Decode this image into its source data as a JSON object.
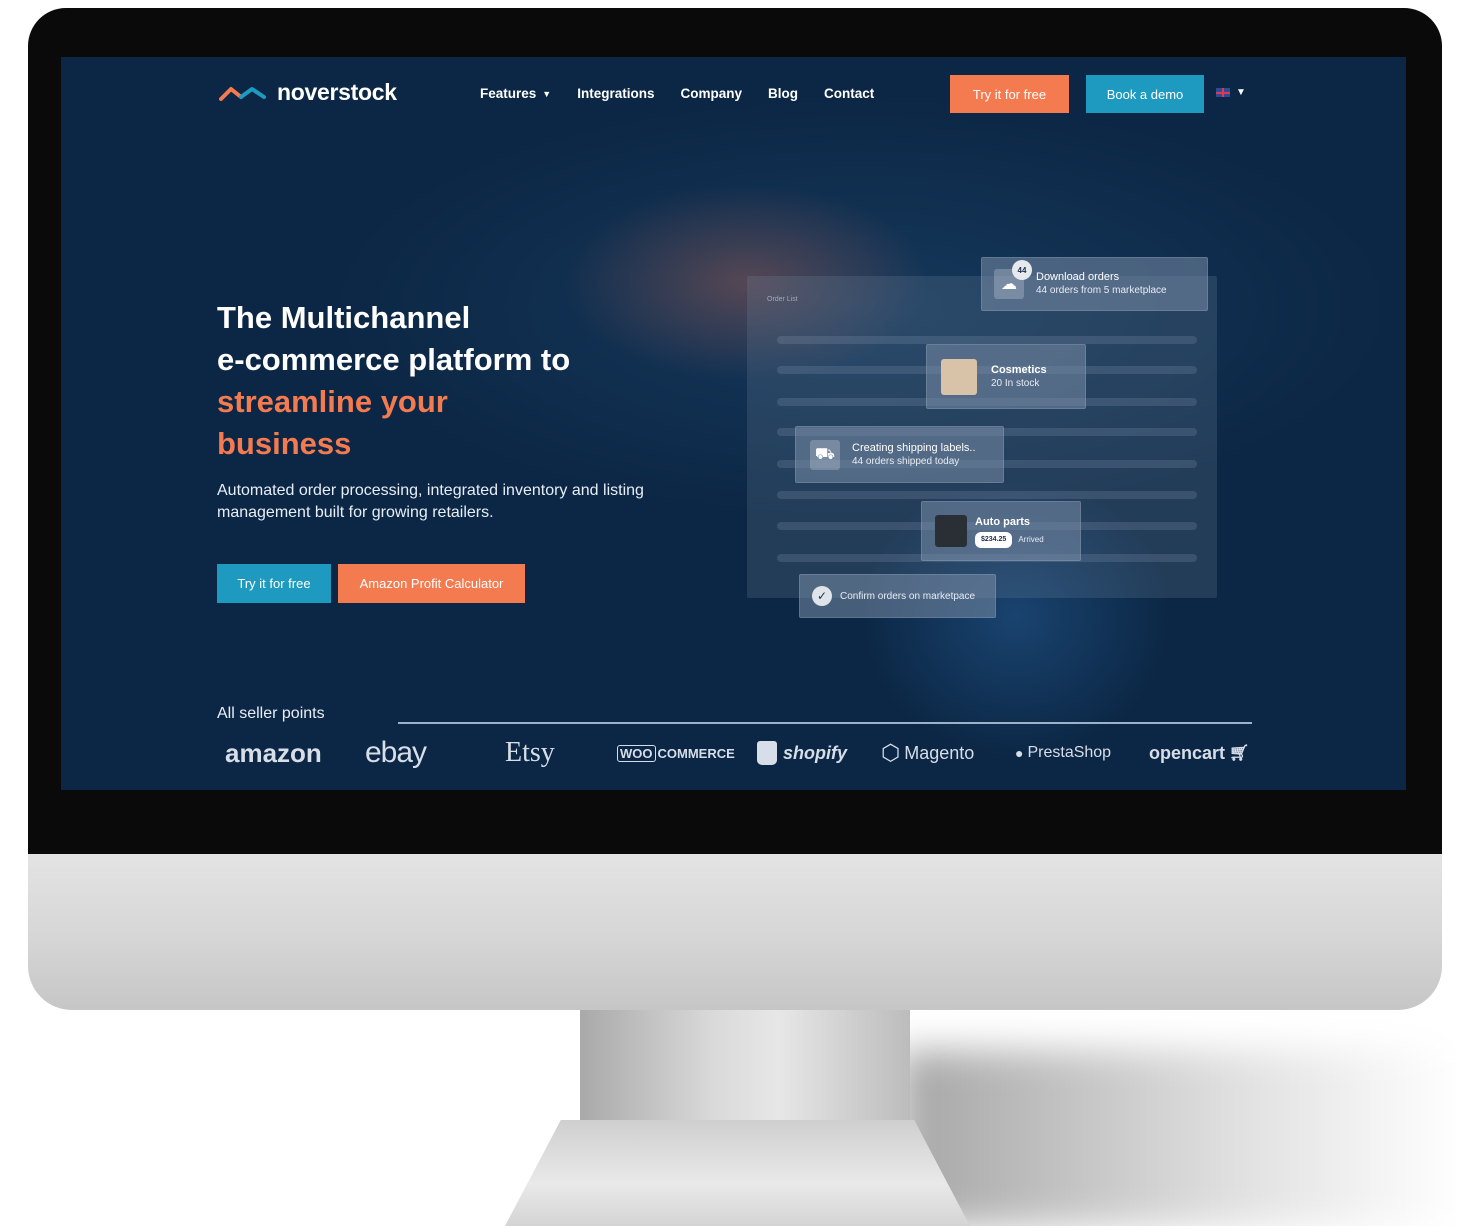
{
  "nav": {
    "logo_text": "noverstock",
    "links": [
      "Features",
      "Integrations",
      "Company",
      "Blog",
      "Contact"
    ],
    "try_label": "Try it for free",
    "demo_label": "Book a demo"
  },
  "hero": {
    "title_line1": "The Multichannel",
    "title_line2": "e-commerce platform to",
    "title_line3": "streamline your",
    "title_line4": "business",
    "subtitle": "Automated order processing, integrated inventory and listing management built for growing retailers.",
    "try_label": "Try it for free",
    "calc_label": "Amazon Profit Calculator"
  },
  "mockup": {
    "panel_label": "Order List",
    "badge": "44",
    "download_title": "Download orders",
    "download_sub": "44 orders from 5 marketplace",
    "cosmetics_title": "Cosmetics",
    "cosmetics_sub": "20 In stock",
    "shipping_title": "Creating shipping labels..",
    "shipping_sub": "44 orders shipped today",
    "auto_title": "Auto parts",
    "auto_price": "$234.25",
    "auto_status": "Arrived",
    "confirm_title": "Confirm orders on marketpace"
  },
  "sellers": {
    "label": "All seller points",
    "brands": [
      "amazon",
      "ebay",
      "Etsy",
      "WOO",
      "COMMERCE",
      "shopify",
      "Magento",
      "PrestaShop",
      "opencart"
    ]
  },
  "colors": {
    "screen_bg": "#0c2745",
    "accent_orange": "#f47a50",
    "accent_teal": "#1e9ac0"
  }
}
